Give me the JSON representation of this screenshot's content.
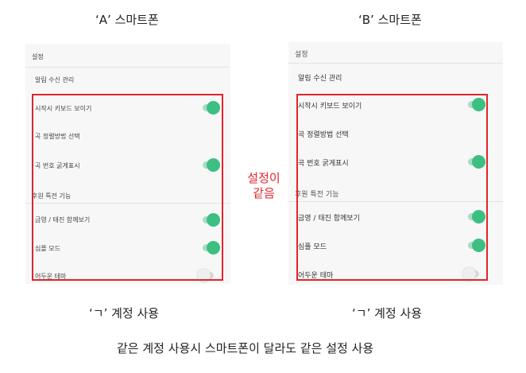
{
  "captions": {
    "phone_a": "‘A’ 스마트폰",
    "phone_b": "‘B’ 스마트폰",
    "account_a": "‘ㄱ’ 계정 사용",
    "account_b": "‘ㄱ’ 계정 사용",
    "summary": "같은 계정 사용시 스마트폰이 달라도 같은 설정 사용"
  },
  "annotation": {
    "line1": "설정이",
    "line2": "같음"
  },
  "panel_a": {
    "section_title": "설정",
    "items": [
      {
        "label": "알림 수신 관리"
      },
      {
        "label": "시작시 키보드 보이기",
        "toggle": "on"
      },
      {
        "label": "곡 정렬방법 선택"
      },
      {
        "label": "곡 번호 굵게표시",
        "toggle": "on"
      },
      {
        "label": "후원 특전 기능"
      },
      {
        "label": "금영 / 태진 함께보기",
        "toggle": "on"
      },
      {
        "label": "심플 모드",
        "toggle": "on"
      },
      {
        "label": "어두운 테마",
        "toggle": "off"
      }
    ]
  },
  "panel_b": {
    "section_title": "설정",
    "items": [
      {
        "label": "알림 수신 관리"
      },
      {
        "label": "시작시 키보드 보이기",
        "toggle": "on"
      },
      {
        "label": "곡 정렬방법 선택"
      },
      {
        "label": "곡 번호 굵게표시",
        "toggle": "on"
      },
      {
        "label": "후원 특전 기능"
      },
      {
        "label": "금영 / 태진 함께보기",
        "toggle": "on"
      },
      {
        "label": "심플 모드",
        "toggle": "on"
      },
      {
        "label": "어두운 테마",
        "toggle": "off"
      }
    ]
  },
  "colors": {
    "accent": "#3dbf82",
    "track_on": "#a9dcc5",
    "highlight": "#e3242b"
  }
}
